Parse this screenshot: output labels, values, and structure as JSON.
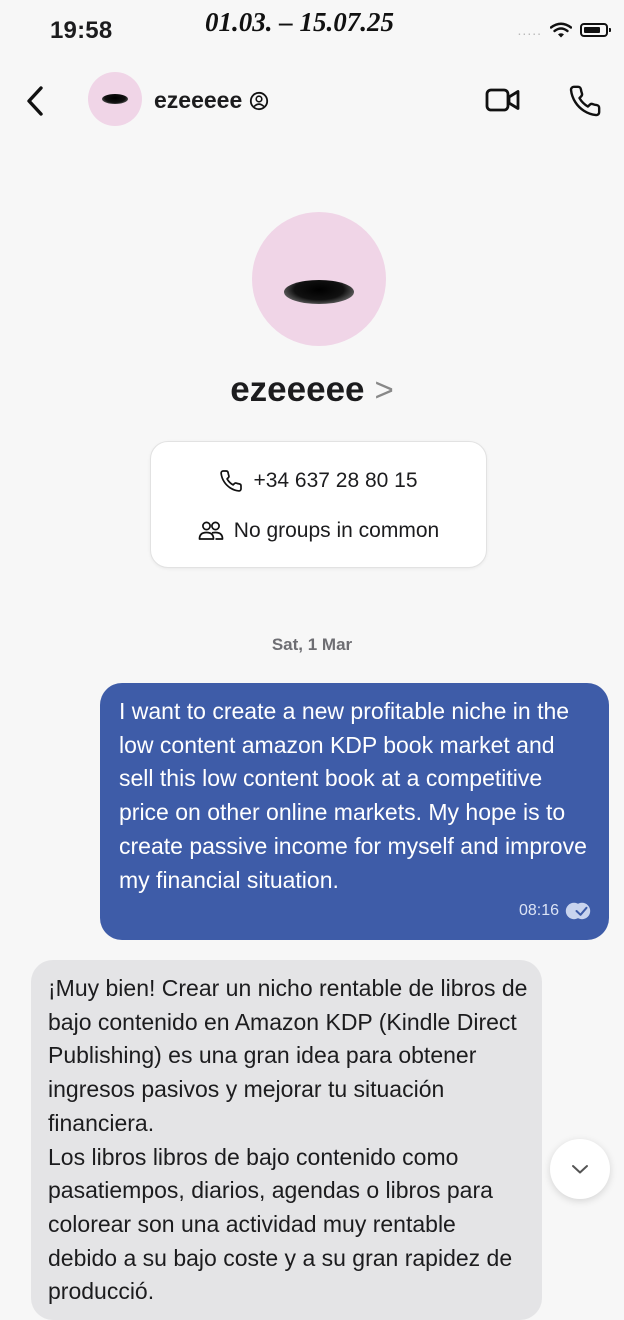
{
  "status_bar": {
    "time": "19:58",
    "signal": "....."
  },
  "overlay": {
    "date_range": "01.03. – 15.07.25"
  },
  "header": {
    "contact_name": "ezeeeee"
  },
  "profile": {
    "name": "ezeeeee",
    "phone": "+34 637 28 80 15",
    "groups": "No groups in common"
  },
  "chat": {
    "date_separator": "Sat, 1 Mar",
    "messages": [
      {
        "direction": "outgoing",
        "text": "I want to create a new profitable niche in the low content amazon KDP book market and sell this low content book at a competitive price on other online markets. My hope is to create passive income for myself and improve my financial situation.",
        "time": "08:16",
        "status": "read"
      },
      {
        "direction": "incoming",
        "text": "¡Muy bien! Crear un nicho rentable de libros de bajo contenido en Amazon KDP (Kindle Direct Publishing) es una gran idea para obtener ingresos pasivos y mejorar tu situación financiera.\nLos libros libros de bajo contenido como pasatiempos, diarios, agendas o libros para colorear son una actividad muy rentable debido a su bajo coste y a su gran rapidez de producció."
      }
    ]
  },
  "colors": {
    "outgoing_bubble": "#3e5ca8",
    "incoming_bubble": "#e4e4e6",
    "avatar_bg": "#f0d5e7",
    "background": "#f7f7f7"
  }
}
